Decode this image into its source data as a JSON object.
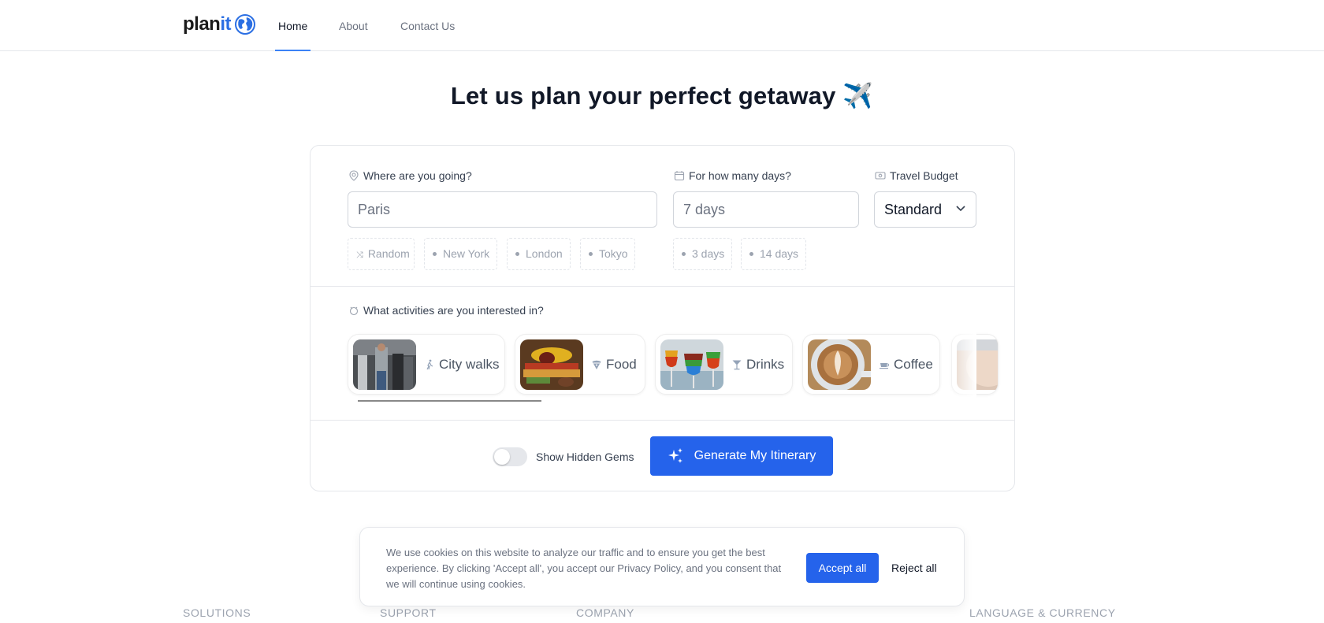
{
  "brand": {
    "part1": "plan",
    "part2": "it",
    "icon": "globe-icon"
  },
  "nav": {
    "links": [
      {
        "label": "Home",
        "active": true
      },
      {
        "label": "About",
        "active": false
      },
      {
        "label": "Contact Us",
        "active": false
      }
    ]
  },
  "hero": {
    "title": "Let us plan your perfect getaway ✈️"
  },
  "form": {
    "destination": {
      "label": "Where are you going?",
      "icon": "map-pin-icon",
      "value": "Paris",
      "suggestions": [
        {
          "label": "Random",
          "icon": "shuffle-icon"
        },
        {
          "label": "New York",
          "icon": "dot"
        },
        {
          "label": "London",
          "icon": "dot"
        },
        {
          "label": "Tokyo",
          "icon": "dot"
        }
      ]
    },
    "days": {
      "label": "For how many days?",
      "icon": "calendar-icon",
      "value": "7 days",
      "suggestions": [
        {
          "label": "3 days"
        },
        {
          "label": "14 days"
        }
      ]
    },
    "budget": {
      "label": "Travel Budget",
      "icon": "money-icon",
      "selected": "Standard"
    },
    "activities": {
      "label": "What activities are you interested in?",
      "icon": "activities-icon",
      "items": [
        {
          "label": "City walks",
          "icon": "walking-icon"
        },
        {
          "label": "Food",
          "icon": "pizza-icon"
        },
        {
          "label": "Drinks",
          "icon": "cocktail-icon"
        },
        {
          "label": "Coffee",
          "icon": "coffee-icon"
        }
      ]
    },
    "hidden_gems": {
      "label": "Show Hidden Gems",
      "on": false
    },
    "generate_label": "Generate My Itinerary"
  },
  "cookie": {
    "text": "We use cookies on this website to analyze our traffic and to ensure you get the best experience. By clicking 'Accept all', you accept our Privacy Policy, and you consent that we will continue using cookies.",
    "accept_label": "Accept all",
    "reject_label": "Reject all"
  },
  "footer": {
    "columns": [
      "SOLUTIONS",
      "SUPPORT",
      "COMPANY",
      "LANGUAGE & CURRENCY"
    ]
  },
  "colors": {
    "accent": "#2563eb",
    "brand": "#2b6fe3"
  }
}
